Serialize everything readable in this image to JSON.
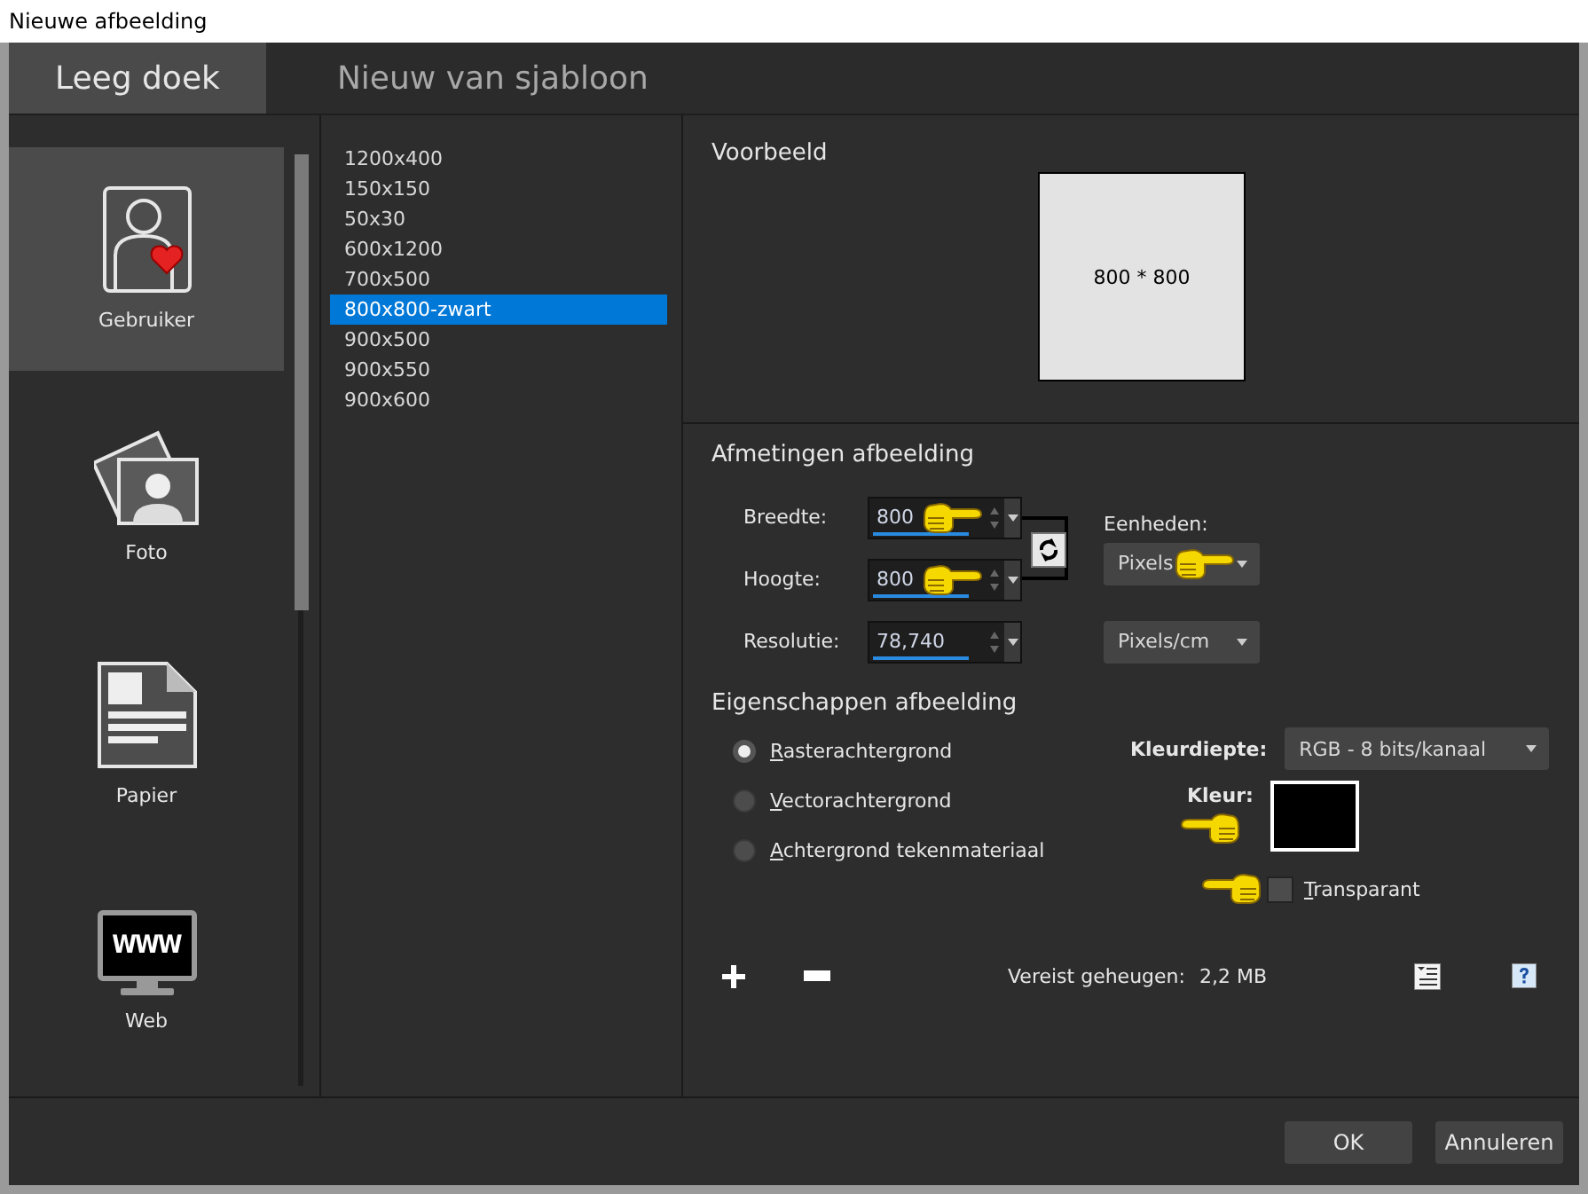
{
  "window": {
    "title": "Nieuwe afbeelding"
  },
  "tabs": [
    {
      "label": "Leeg doek",
      "selected": true
    },
    {
      "label": "Nieuw van sjabloon",
      "selected": false
    }
  ],
  "categories": [
    {
      "label": "Gebruiker",
      "kind": "user",
      "selected": true
    },
    {
      "label": "Foto",
      "kind": "photo",
      "selected": false
    },
    {
      "label": "Papier",
      "kind": "paper",
      "selected": false
    },
    {
      "label": "Web",
      "kind": "web",
      "selected": false,
      "icon_text": "WWW"
    }
  ],
  "presets": [
    {
      "label": "1200x400",
      "selected": false
    },
    {
      "label": "150x150",
      "selected": false
    },
    {
      "label": "50x30",
      "selected": false
    },
    {
      "label": "600x1200",
      "selected": false
    },
    {
      "label": "700x500",
      "selected": false
    },
    {
      "label": "800x800-zwart",
      "selected": true
    },
    {
      "label": "900x500",
      "selected": false
    },
    {
      "label": "900x550",
      "selected": false
    },
    {
      "label": "900x600",
      "selected": false
    }
  ],
  "preview": {
    "heading": "Voorbeeld",
    "caption": "800 * 800"
  },
  "dimensions": {
    "heading": "Afmetingen afbeelding",
    "fields": [
      {
        "label": "Breedte:",
        "value": "800",
        "pointer": true
      },
      {
        "label": "Hoogte:",
        "value": "800",
        "pointer": true
      },
      {
        "label": "Resolutie:",
        "value": "78,740",
        "pointer": false
      }
    ],
    "units_label": "Eenheden:",
    "units": {
      "value": "Pixels",
      "pointer": true
    },
    "resolution_units": {
      "value": "Pixels/cm"
    }
  },
  "properties": {
    "heading": "Eigenschappen afbeelding",
    "backgrounds": [
      {
        "label": "Rasterachtergrond",
        "selected": true
      },
      {
        "label": "Vectorachtergrond",
        "selected": false
      },
      {
        "label": "Achtergrond tekenmateriaal",
        "selected": false
      }
    ],
    "depth": {
      "label": "Kleurdiepte:",
      "value": "RGB - 8 bits/kanaal"
    },
    "color": {
      "label": "Kleur:",
      "color": "#000000",
      "pointer": true
    },
    "transparent": {
      "label": "Transparant",
      "checked": false,
      "pointer": true
    }
  },
  "memory": {
    "label": "Vereist geheugen:",
    "value": "2,2 MB"
  },
  "buttons": [
    {
      "label": "OK"
    },
    {
      "label": "Annuleren"
    }
  ]
}
